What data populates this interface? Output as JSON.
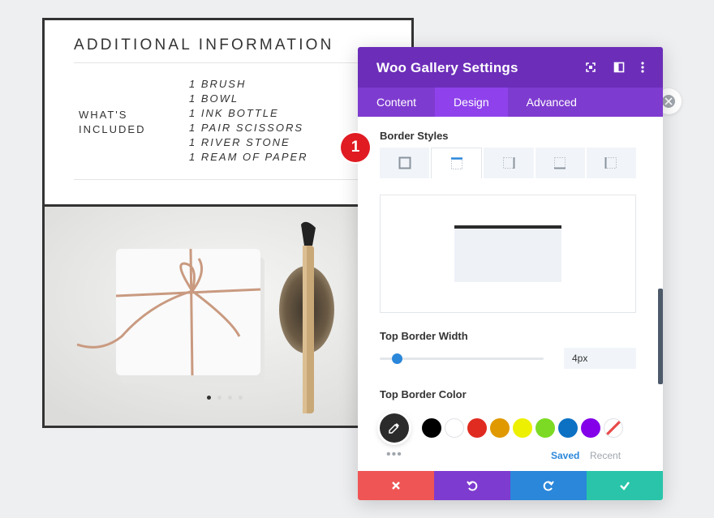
{
  "product": {
    "info_title": "ADDITIONAL INFORMATION",
    "included_label": "WHAT'S INCLUDED",
    "included_items": [
      "1 BRUSH",
      "1 BOWL",
      "1 INK BOTTLE",
      "1 PAIR SCISSORS",
      "1 RIVER STONE",
      "1 REAM OF PAPER"
    ]
  },
  "gallery": {
    "slide_count": 4,
    "active_slide": 1
  },
  "modal": {
    "title": "Woo Gallery Settings",
    "tabs": [
      {
        "label": "Content",
        "active": false
      },
      {
        "label": "Design",
        "active": true
      },
      {
        "label": "Advanced",
        "active": false
      }
    ],
    "border_styles_label": "Border Styles",
    "border_tabs": [
      "all-borders-icon",
      "top-border-icon",
      "right-border-icon",
      "bottom-border-icon",
      "left-border-icon"
    ],
    "active_border_tab": 1,
    "top_border_width_label": "Top Border Width",
    "top_border_width_value": "4px",
    "top_border_width_slider": 0.09,
    "top_border_color_label": "Top Border Color",
    "swatches": [
      "#000000",
      "#ffffff",
      "#e02b20",
      "#e09900",
      "#edf000",
      "#7cda24",
      "#0c71c3",
      "#8300e9"
    ],
    "saved_label": "Saved",
    "recent_label": "Recent",
    "footer_colors": {
      "discard": "#ef5555",
      "undo": "#7e3bd0",
      "redo": "#2b87da",
      "save": "#29c4a9"
    },
    "accent": "#6c2eb9"
  },
  "callout_number": "1"
}
